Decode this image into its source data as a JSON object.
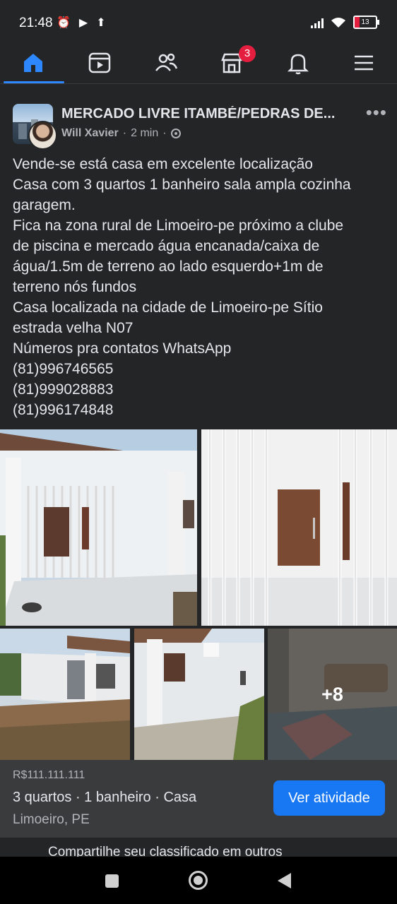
{
  "status_bar": {
    "time": "21:48",
    "battery": "13"
  },
  "nav": {
    "marketplace_badge": "3"
  },
  "post": {
    "group_name": "MERCADO LIVRE ITAMBÉ/PEDRAS DE...",
    "author": "Will Xavier",
    "time": "2 min",
    "separator": "·",
    "more": "•••",
    "text_lines": [
      "Vende-se está casa em excelente localização",
      "Casa com 3 quartos 1 banheiro sala ampla cozinha",
      "garagem.",
      "Fica na zona rural de Limoeiro-pe próximo a clube",
      "de piscina e mercado água encanada/caixa de",
      "água/1.5m de terreno ao lado esquerdo+1m de",
      "terreno nós fundos",
      "Casa localizada na cidade de Limoeiro-pe Sítio",
      "estrada velha N07",
      "Números pra contatos WhatsApp",
      "(81)996746565",
      "(81)999028883",
      "(81)996174848"
    ],
    "more_photos": "+8"
  },
  "listing": {
    "price": "R$111.111.111",
    "details": "3 quartos · 1 banheiro · Casa",
    "location": "Limoeiro, PE",
    "cta": "Ver atividade"
  },
  "share": {
    "text": "Compartilhe seu classificado em outros"
  },
  "colors": {
    "background": "#242526",
    "accent": "#1877f2",
    "badge": "#e41e3f"
  }
}
